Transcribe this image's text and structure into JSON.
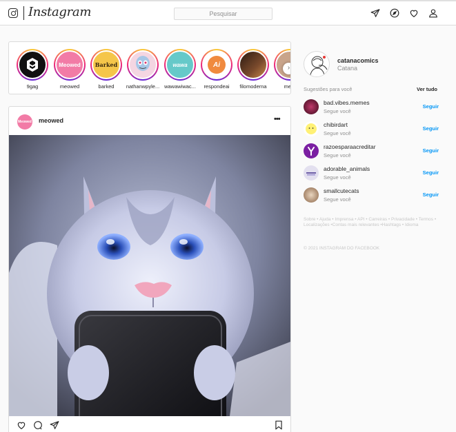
{
  "header": {
    "logo_text": "Instagram",
    "search_placeholder": "Pesquisar"
  },
  "stories": [
    {
      "name": "9gag",
      "color": "#111111",
      "inner": "9"
    },
    {
      "name": "meowed",
      "color": "#f27ba6",
      "inner": "Meowed"
    },
    {
      "name": "barked",
      "color": "#f5c64a",
      "inner": "Barked"
    },
    {
      "name": "nathanwpyle...",
      "color": "#e8a9c1",
      "inner": ""
    },
    {
      "name": "wawawiwac...",
      "color": "#66c9c9",
      "inner": "wawa"
    },
    {
      "name": "respondeai",
      "color": "#f08a3e",
      "inner": "Ai"
    },
    {
      "name": "filomoderna",
      "color": "#5a2e1e",
      "inner": ""
    },
    {
      "name": "mem",
      "color": "#c9a48a",
      "inner": ""
    }
  ],
  "post": {
    "username": "meowed",
    "avatar_text": "Meowed"
  },
  "profile": {
    "username": "catanacomics",
    "name": "Catana"
  },
  "suggestions": {
    "title": "Sugestões para você",
    "see_all": "Ver tudo",
    "items": [
      {
        "username": "bad.vibes.memes",
        "subtitle": "Segue você",
        "action": "Seguir",
        "color": "#7a1f3a"
      },
      {
        "username": "chibirdart",
        "subtitle": "Segue você",
        "action": "Seguir",
        "color": "#fff176"
      },
      {
        "username": "razoesparaacreditar",
        "subtitle": "Segue você",
        "action": "Seguir",
        "color": "#7b1fa2"
      },
      {
        "username": "adorable_animals",
        "subtitle": "Segue você",
        "action": "Seguir",
        "color": "#e3e0ef"
      },
      {
        "username": "smallcutecats",
        "subtitle": "Segue você",
        "action": "Seguir",
        "color": "#a07a5a"
      }
    ]
  },
  "footer": {
    "links": "Sobre • Ajuda • Imprensa • API • Carreiras • Privacidade • Termos • Localizações •Contas mais relevantes •Hashtags • Idioma",
    "copyright": "© 2021 INSTAGRAM DO FACEBOOK"
  }
}
